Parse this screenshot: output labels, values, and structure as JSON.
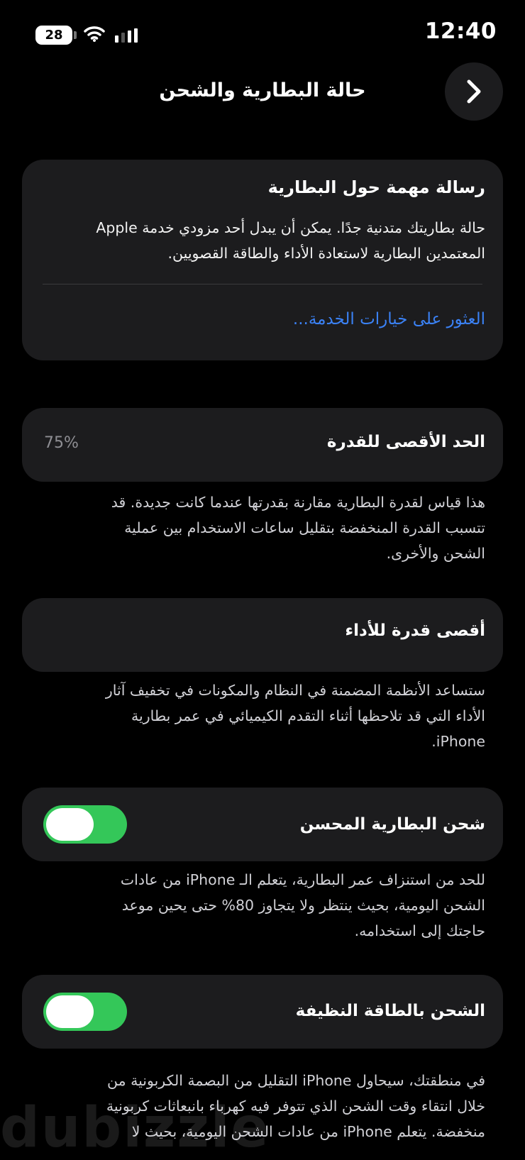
{
  "status_bar": {
    "time": "12:40",
    "battery_level": "28",
    "icons": [
      "wifi-icon",
      "cellular-signal-icon",
      "battery-icon"
    ]
  },
  "header": {
    "title": "حالة البطارية والشحن",
    "back_icon": "chevron-right-icon"
  },
  "important_message": {
    "title": "رسالة مهمة حول البطارية",
    "body_lines": [
      "حالة بطاريتك متدنية جدًا. يمكن أن يبدل أحد مزودي خدمة Apple",
      "المعتمدين البطارية لاستعادة الأداء والطاقة القصويين."
    ],
    "link": "العثور على خيارات الخدمة..."
  },
  "maximum_capacity": {
    "label": "الحد الأقصى للقدرة",
    "value": "75%",
    "note_lines": [
      "هذا قياس لقدرة البطارية مقارنة بقدرتها عندما كانت جديدة. قد",
      "تتسبب القدرة المنخفضة بتقليل ساعات الاستخدام بين عملية",
      "الشحن والأخرى."
    ]
  },
  "peak_performance": {
    "label": "أقصى قدرة للأداء",
    "note_lines": [
      "ستساعد الأنظمة المضمنة في النظام والمكونات في تخفيف آثار",
      "الأداء التي قد تلاحظها أثناء التقدم الكيميائي في عمر بطارية",
      "iPhone."
    ]
  },
  "optimized_charging": {
    "label": "شحن البطارية المحسن",
    "enabled": true,
    "note_lines": [
      "للحد من استنزاف عمر البطارية، يتعلم الـ iPhone من عادات",
      "الشحن اليومية، بحيث ينتظر ولا يتجاوز 80% حتى يحين موعد",
      "حاجتك إلى استخدامه."
    ]
  },
  "clean_energy_charging": {
    "label": "الشحن بالطاقة النظيفة",
    "enabled": true,
    "note_lines": [
      "في منطقتك، سيحاول iPhone التقليل من البصمة الكربونية من",
      "خلال انتقاء وقت الشحن الذي تتوفر فيه كهرباء بانبعاثات كربونية",
      "منخفضة. يتعلم iPhone من عادات الشحن اليومية، بحيث لا"
    ]
  },
  "accent_colors": {
    "link_blue": "#3b82f6",
    "toggle_green": "#34c759",
    "card_bg": "#1c1c1e"
  },
  "watermark": "dubizzle"
}
